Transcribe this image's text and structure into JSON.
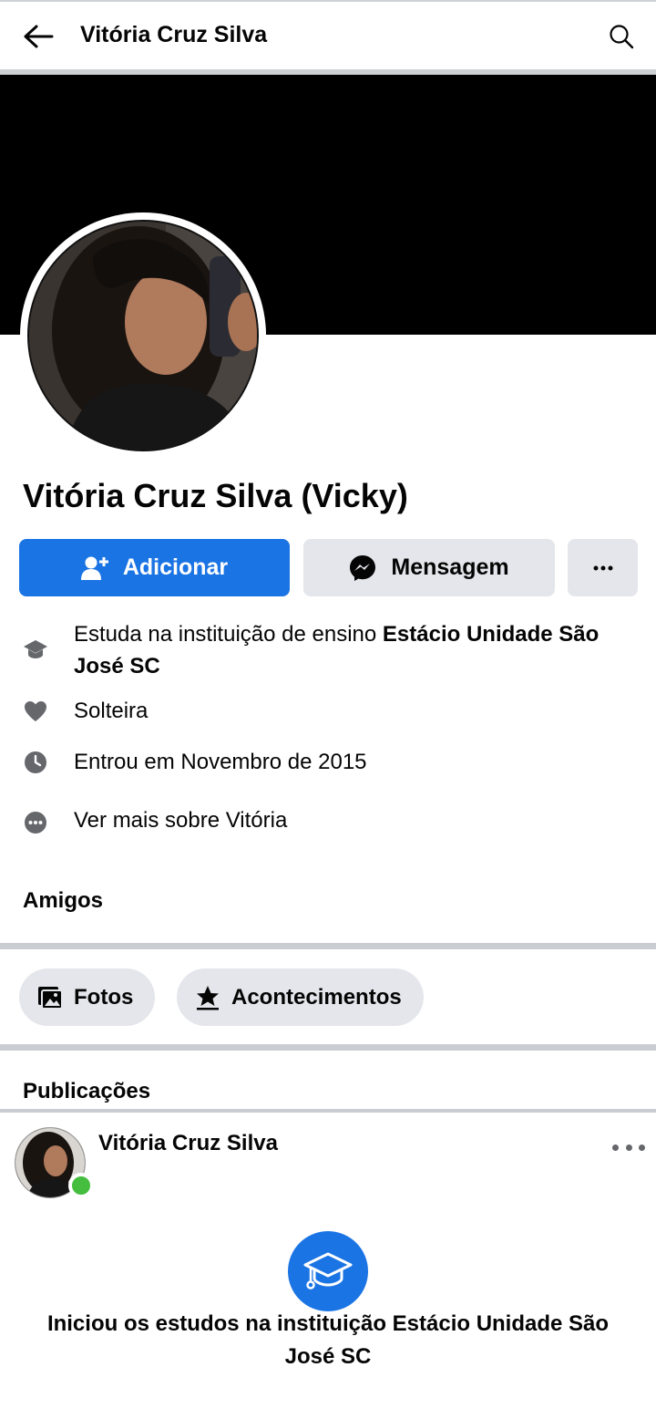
{
  "header": {
    "title": "Vitória Cruz Silva"
  },
  "profile": {
    "name": "Vitória Cruz Silva (Vicky)"
  },
  "actions": {
    "add_label": "Adicionar",
    "message_label": "Mensagem",
    "more_label": "···"
  },
  "info": {
    "education_prefix": "Estuda na instituição de ensino ",
    "education_bold": "Estácio Unidade São José SC",
    "relationship": "Solteira",
    "joined": "Entrou em Novembro de 2015",
    "see_more": "Ver mais sobre Vitória"
  },
  "sections": {
    "friends": "Amigos",
    "posts": "Publicações"
  },
  "chips": {
    "photos": "Fotos",
    "events": "Acontecimentos"
  },
  "post": {
    "author": "Vitória Cruz Silva",
    "event_text": "Iniciou os estudos na instituição Estácio Unidade São José SC"
  },
  "colors": {
    "primary": "#1b74e4",
    "online": "#45bd3e",
    "cover": "#000000"
  },
  "icons": [
    "back-arrow-icon",
    "search-icon",
    "add-friend-icon",
    "messenger-icon",
    "graduation-cap-icon",
    "heart-icon",
    "clock-icon",
    "more-dots-icon",
    "photos-icon",
    "star-award-icon",
    "graduation-event-icon"
  ]
}
